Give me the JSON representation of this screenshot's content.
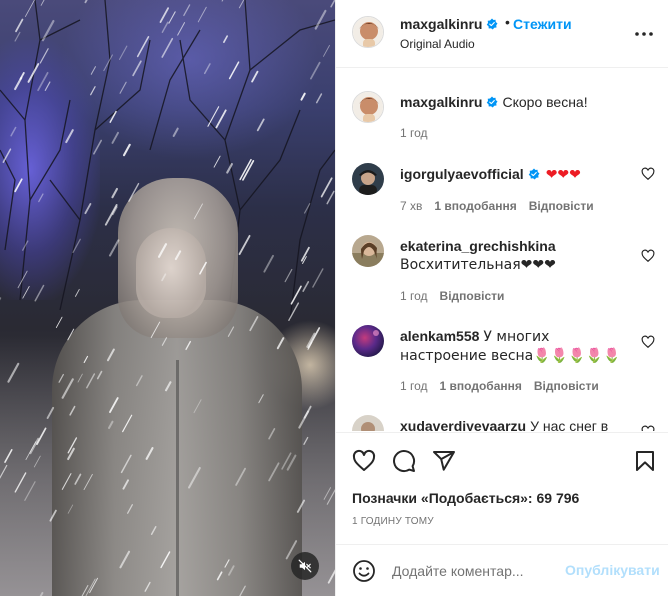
{
  "header": {
    "username": "maxgalkinru",
    "separator": "•",
    "follow_label": "Стежити",
    "audio_label": "Original Audio"
  },
  "caption": {
    "username": "maxgalkinru",
    "text": "Скоро весна!",
    "time": "1 год"
  },
  "comments": [
    {
      "username": "igorgulyaevofficial",
      "verified": true,
      "text": "❤❤❤",
      "time": "7 хв",
      "likes": "1 вподобання",
      "reply": "Відповісти"
    },
    {
      "username": "ekaterina_grechishkina",
      "verified": false,
      "text": "Восхитительная❤❤❤",
      "time": "1 год",
      "likes": "",
      "reply": "Відповісти"
    },
    {
      "username": "alenkam558",
      "verified": false,
      "text": "У многих настроение весна🌷🌷🌷🌷🌷",
      "time": "1 год",
      "likes": "1 вподобання",
      "reply": "Відповісти"
    },
    {
      "username": "xudaverdiyevaarzu",
      "verified": false,
      "text": "У нас снег в",
      "time": "",
      "likes": "",
      "reply": ""
    }
  ],
  "likes_label": "Позначки «Подобається»: 69 796",
  "time_ago": "1 годину тому",
  "comment_box": {
    "placeholder": "Додайте коментар...",
    "publish_label": "Опублікувати"
  },
  "icons": {
    "verified": "verified-badge-icon",
    "more": "more-options-icon",
    "like": "heart-icon",
    "comment": "comment-icon",
    "share": "share-icon",
    "save": "bookmark-icon",
    "emoji": "emoji-icon",
    "mute": "muted-speaker-icon"
  },
  "colors": {
    "accent": "#0095f6",
    "publish_disabled": "#b2dffc",
    "verified": "#0095f6",
    "muted_text": "#737373"
  }
}
